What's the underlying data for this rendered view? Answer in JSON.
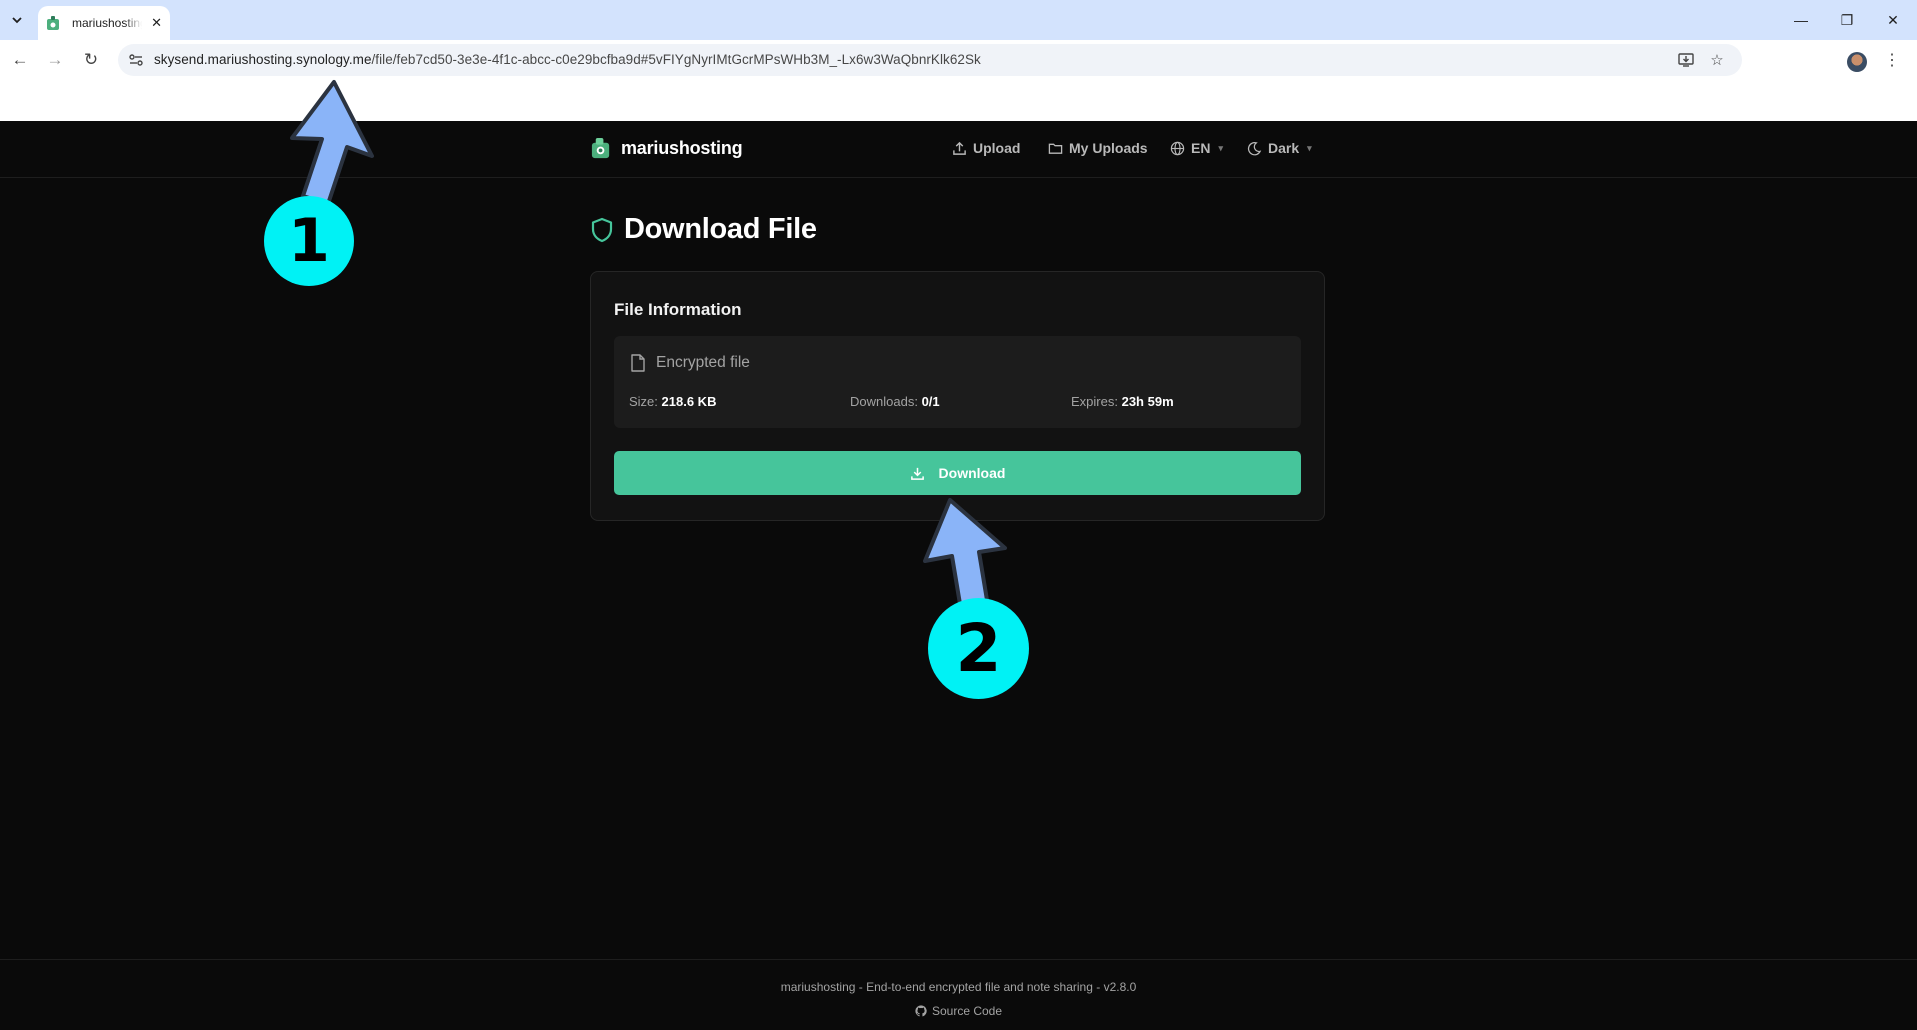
{
  "browser": {
    "tab": {
      "title": "mariushosting"
    },
    "url": {
      "host": "skysend.mariushosting.synology.me",
      "path": "/file/feb7cd50-3e3e-4f1c-abcc-c0e29bcfba9d#5vFIYgNyrIMtGcrMPsWHb3M_-Lx6w3WaQbnrKlk62Sk"
    }
  },
  "app": {
    "brand": "mariushosting",
    "nav": {
      "upload": "Upload",
      "my_uploads": "My Uploads",
      "language": "EN",
      "theme": "Dark"
    },
    "page_title": "Download File",
    "card": {
      "title": "File Information",
      "file_name": "Encrypted file",
      "size_label": "Size:",
      "size_value": "218.6 KB",
      "downloads_label": "Downloads:",
      "downloads_value": "0/1",
      "expires_label": "Expires:",
      "expires_value": "23h 59m",
      "download_button": "Download"
    },
    "footer": {
      "text": "mariushosting - End-to-end encrypted file and note sharing - v2.8.0",
      "source_link": "Source Code"
    }
  },
  "annotations": {
    "step1": "1",
    "step2": "2"
  },
  "colors": {
    "accent": "#46c59b",
    "background": "#0a0a0a",
    "annotation_circle": "#00f2f5",
    "annotation_arrow": "#8ab4f8"
  }
}
